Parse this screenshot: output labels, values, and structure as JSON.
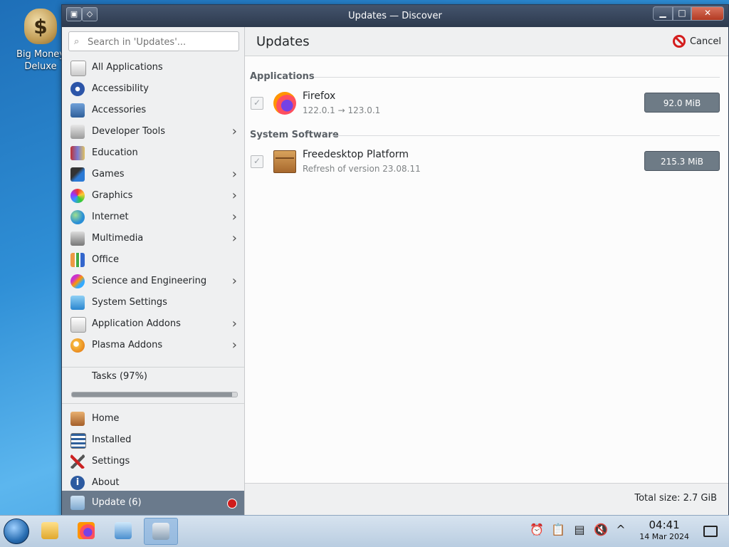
{
  "desktop": {
    "icon_label": "Big Money Deluxe"
  },
  "window": {
    "title": "Updates — Discover"
  },
  "search": {
    "placeholder": "Search in 'Updates'..."
  },
  "sidebar": {
    "items": [
      {
        "label": "All Applications",
        "chevron": false
      },
      {
        "label": "Accessibility",
        "chevron": false
      },
      {
        "label": "Accessories",
        "chevron": false
      },
      {
        "label": "Developer Tools",
        "chevron": true
      },
      {
        "label": "Education",
        "chevron": false
      },
      {
        "label": "Games",
        "chevron": true
      },
      {
        "label": "Graphics",
        "chevron": true
      },
      {
        "label": "Internet",
        "chevron": true
      },
      {
        "label": "Multimedia",
        "chevron": true
      },
      {
        "label": "Office",
        "chevron": false
      },
      {
        "label": "Science and Engineering",
        "chevron": true
      },
      {
        "label": "System Settings",
        "chevron": false
      },
      {
        "label": "Application Addons",
        "chevron": true
      },
      {
        "label": "Plasma Addons",
        "chevron": true
      }
    ],
    "tasks_label": "Tasks (97%)",
    "tasks_progress": 0.97,
    "bottom_items": [
      {
        "label": "Home"
      },
      {
        "label": "Installed"
      },
      {
        "label": "Settings"
      },
      {
        "label": "About"
      }
    ],
    "update_label": "Update (6)"
  },
  "header": {
    "title": "Updates",
    "cancel_label": "Cancel"
  },
  "sections": [
    {
      "title": "Applications",
      "rows": [
        {
          "name": "Firefox",
          "detail": "122.0.1 → 123.0.1",
          "size": "92.0 MiB",
          "icon": "firefox-icon"
        }
      ]
    },
    {
      "title": "System Software",
      "rows": [
        {
          "name": "Freedesktop Platform",
          "detail": "Refresh of version 23.08.11",
          "size": "215.3 MiB",
          "icon": "package-box-icon"
        }
      ]
    }
  ],
  "footer": {
    "total_size": "Total size: 2.7 GiB"
  },
  "taskbar": {
    "time": "04:41",
    "date": "14 Mar 2024"
  },
  "colors": {
    "selected_bg": "#6a7a8c",
    "accent_red": "#d41d1d"
  }
}
